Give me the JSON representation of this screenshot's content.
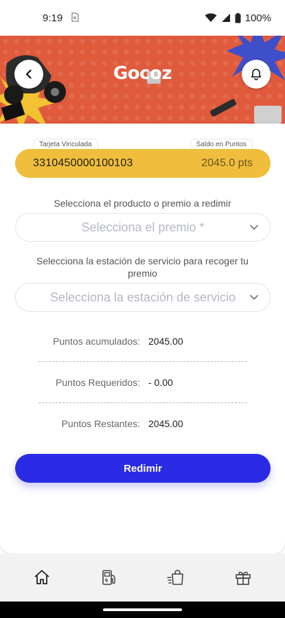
{
  "status_bar": {
    "time": "9:19",
    "battery": "100%",
    "icons": [
      "sim-icon",
      "wifi-icon",
      "signal-icon",
      "battery-icon"
    ]
  },
  "banner": {
    "brand": "Gocoz",
    "background_color": "#e05a3c",
    "icons": [
      "back-arrow-icon",
      "bell-icon"
    ]
  },
  "card": {
    "linked_label": "Tarjeta Vinculada",
    "balance_label": "Saldo en Puntos",
    "number": "3310450000100103",
    "points": "2045.0 pts",
    "color": "#f0be3c"
  },
  "form": {
    "product_label": "Selecciona el producto o premio a redimir",
    "product_placeholder": "Selecciona el premio *",
    "station_label": "Selecciona la estación de servicio para recoger tu premio",
    "station_placeholder": "Selecciona la estación de servicio"
  },
  "summary": {
    "accumulated_label": "Puntos acumulados:",
    "accumulated_value": "2045.00",
    "required_label": "Puntos Requeridos:",
    "required_value": "- 0.00",
    "remaining_label": "Puntos Restantes:",
    "remaining_value": "2045.00"
  },
  "actions": {
    "redeem_label": "Redimir",
    "accent_color": "#2b2be6"
  },
  "bottom_nav": {
    "items": [
      "home-icon",
      "fuel-station-icon",
      "shopping-bag-icon",
      "gift-icon"
    ]
  }
}
